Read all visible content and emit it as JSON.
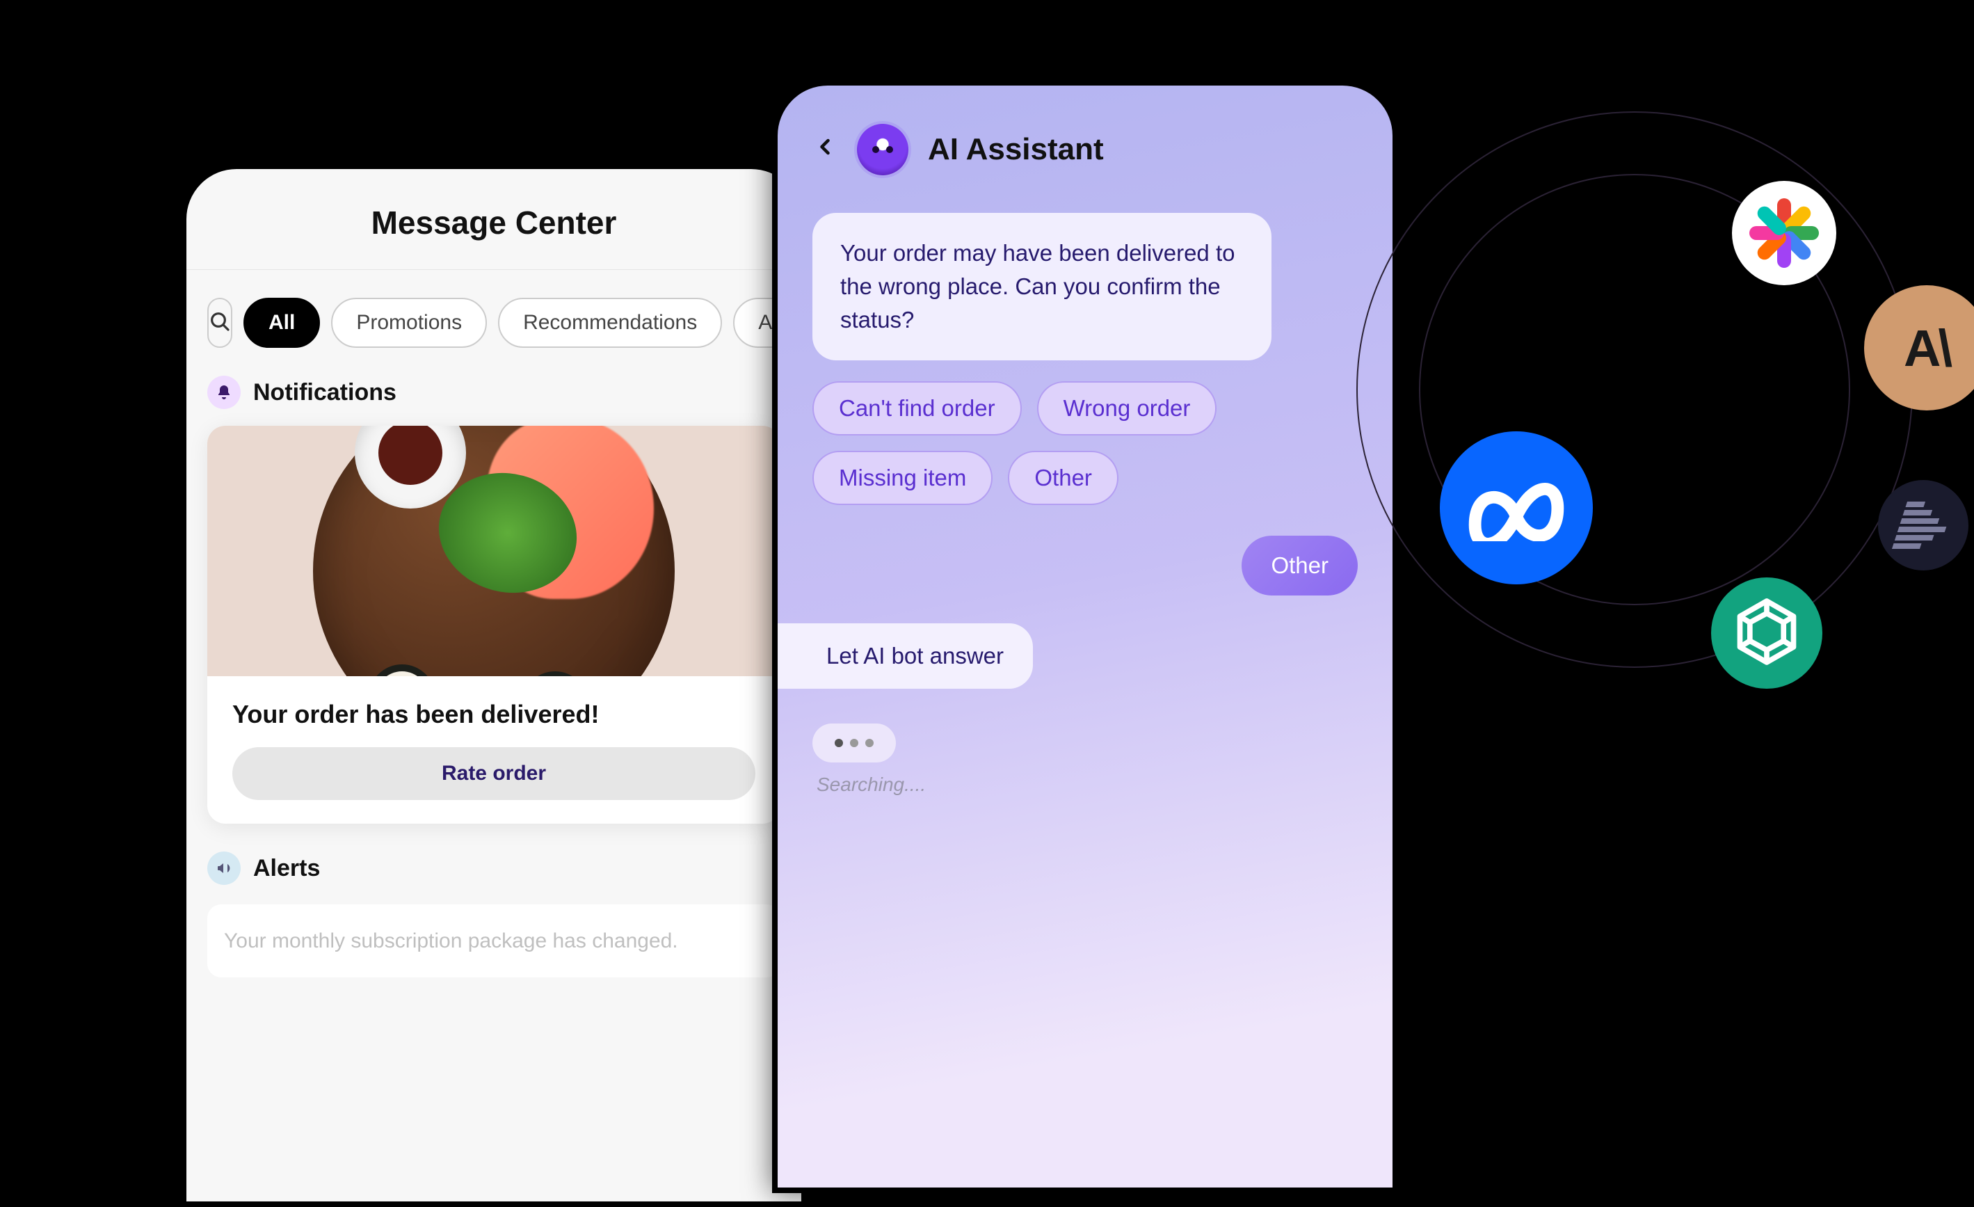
{
  "message_center": {
    "title": "Message Center",
    "filters": {
      "search_icon": "search",
      "tabs": [
        "All",
        "Promotions",
        "Recommendations",
        "A"
      ],
      "active_index": 0
    },
    "notifications": {
      "icon": "bell",
      "heading": "Notifications",
      "card": {
        "image_alt": "sushi-plate",
        "title": "Your order has been delivered!",
        "button": "Rate order"
      }
    },
    "alerts": {
      "icon": "megaphone",
      "heading": "Alerts",
      "card_text": "Your monthly subscription package has changed."
    }
  },
  "ai_assistant": {
    "back_icon": "chevron-left",
    "avatar_icon": "robot-face",
    "title": "AI Assistant",
    "assistant_message": "Your order may have been delivered to the wrong place. Can you confirm the status?",
    "quick_replies": [
      "Can't find order",
      "Wrong order",
      "Missing item",
      "Other"
    ],
    "user_selection": "Other",
    "system_bubble": "Let AI bot answer",
    "status_text": "Searching...."
  },
  "orbit": {
    "logos": [
      {
        "id": "meta",
        "name": "meta-logo",
        "color": "#0866ff"
      },
      {
        "id": "palm",
        "name": "google-palm-logo",
        "color": "#ffffff"
      },
      {
        "id": "anthropic",
        "name": "anthropic-logo",
        "label": "A\\",
        "color": "#d09b6f"
      },
      {
        "id": "mistral",
        "name": "mistral-logo",
        "color": "#1a1b2d"
      },
      {
        "id": "openai",
        "name": "openai-logo",
        "color": "#12a37f"
      }
    ]
  }
}
